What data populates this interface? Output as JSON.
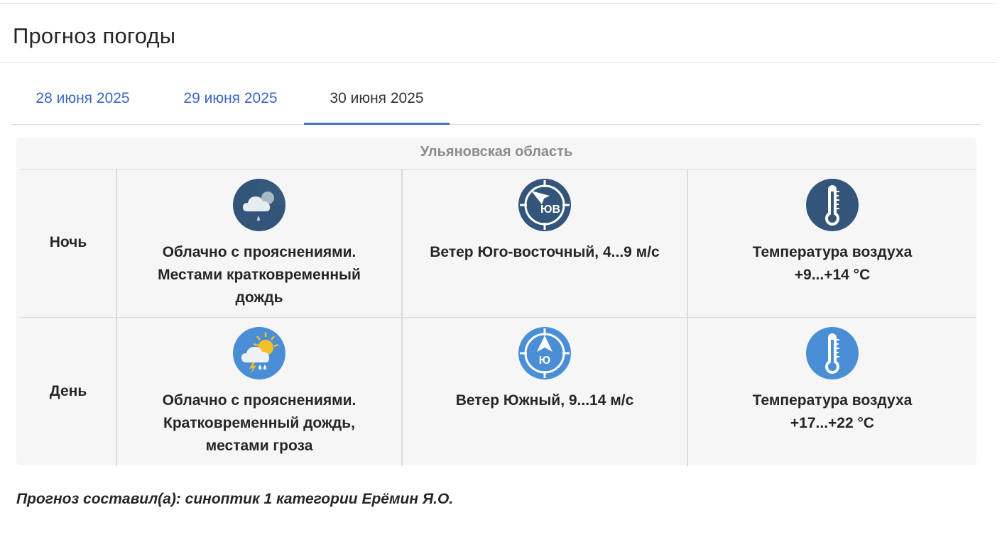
{
  "header": {
    "title": "Прогноз погоды"
  },
  "tabs": [
    {
      "label": "28 июня 2025",
      "active": false
    },
    {
      "label": "29 июня 2025",
      "active": false
    },
    {
      "label": "30 июня 2025",
      "active": true
    }
  ],
  "forecast": {
    "region": "Ульяновская область",
    "rows": [
      {
        "period": "Ночь",
        "weather": "Облачно с прояснениями.\nМестами кратковременный\nдождь",
        "weather_icon": "cloudy-rain-night-icon",
        "wind": "Ветер Юго-восточный, 4...9 м/с",
        "wind_icon": "wind-southeast-icon",
        "wind_dir_abbr": "ЮВ",
        "temperature": "Температура воздуха\n+9...+14 °С",
        "temperature_icon": "thermometer-icon"
      },
      {
        "period": "День",
        "weather": "Облачно с прояснениями.\nКратковременный дождь,\nместами гроза",
        "weather_icon": "partly-cloudy-thunderstorm-icon",
        "wind": "Ветер Южный, 9...14 м/с",
        "wind_icon": "wind-south-icon",
        "wind_dir_abbr": "Ю",
        "temperature": "Температура воздуха\n+17...+22 °С",
        "temperature_icon": "thermometer-icon"
      }
    ]
  },
  "author": "Прогноз составил(а): синоптик 1 категории Ерёмин Я.О.",
  "colors": {
    "accent": "#3c66c6",
    "night_icon_bg": "#335579",
    "day_icon_bg": "#4a8fd6",
    "card_bg": "#f6f6f6"
  }
}
